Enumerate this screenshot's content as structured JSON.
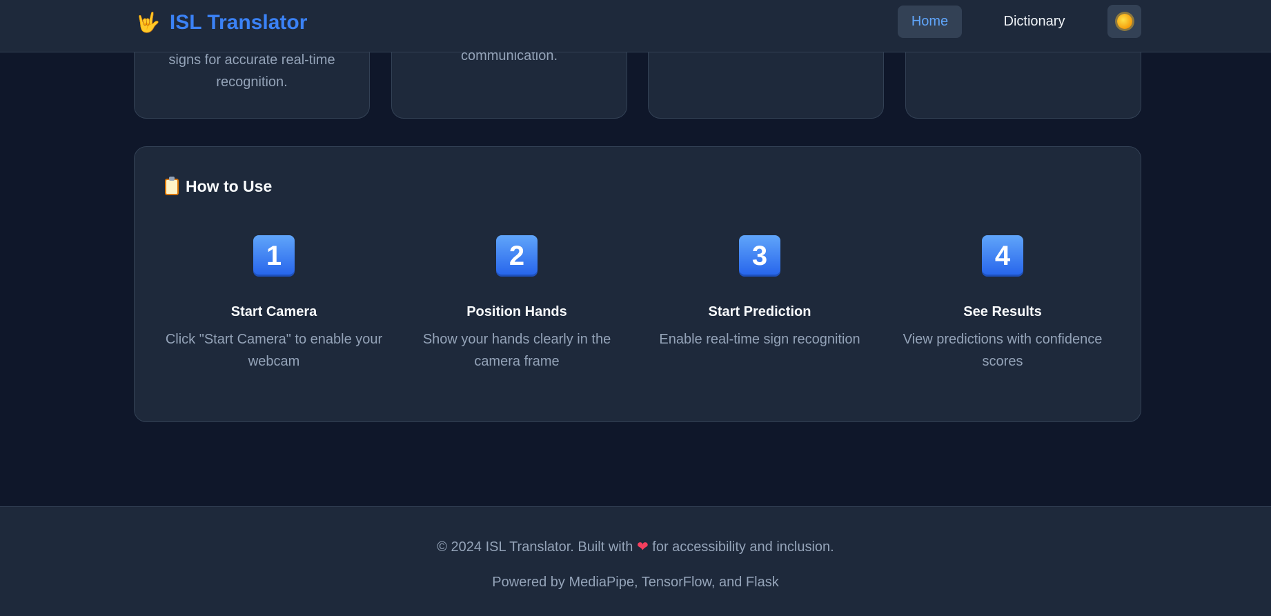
{
  "header": {
    "brand_icon": "🤟",
    "brand_name": "ISL Translator",
    "nav": {
      "home": "Home",
      "dictionary": "Dictionary"
    },
    "theme_toggle_icon": "sun-icon"
  },
  "feature_cards": [
    {
      "line1": "signs for accurate real-time",
      "line2": "recognition."
    },
    {
      "line1": "communication."
    },
    {},
    {}
  ],
  "how_to": {
    "title_icon": "clipboard-icon",
    "title": "How to Use",
    "steps": [
      {
        "num": "1",
        "title": "Start Camera",
        "desc_line1": "Click \"Start Camera\" to enable your",
        "desc_line2": "webcam"
      },
      {
        "num": "2",
        "title": "Position Hands",
        "desc_line1": "Show your hands clearly in the",
        "desc_line2": "camera frame"
      },
      {
        "num": "3",
        "title": "Start Prediction",
        "desc_line1": "Enable real-time sign recognition",
        "desc_line2": ""
      },
      {
        "num": "4",
        "title": "See Results",
        "desc_line1": "View predictions with confidence",
        "desc_line2": "scores"
      }
    ]
  },
  "footer": {
    "line1_a": "© 2024 ISL Translator. Built with",
    "line1_heart": "❤",
    "line1_b": "for accessibility and inclusion.",
    "line2": "Powered by MediaPipe, TensorFlow, and Flask"
  },
  "colors": {
    "background": "#0f172a",
    "surface": "#1e293b",
    "accent": "#3b82f6"
  }
}
